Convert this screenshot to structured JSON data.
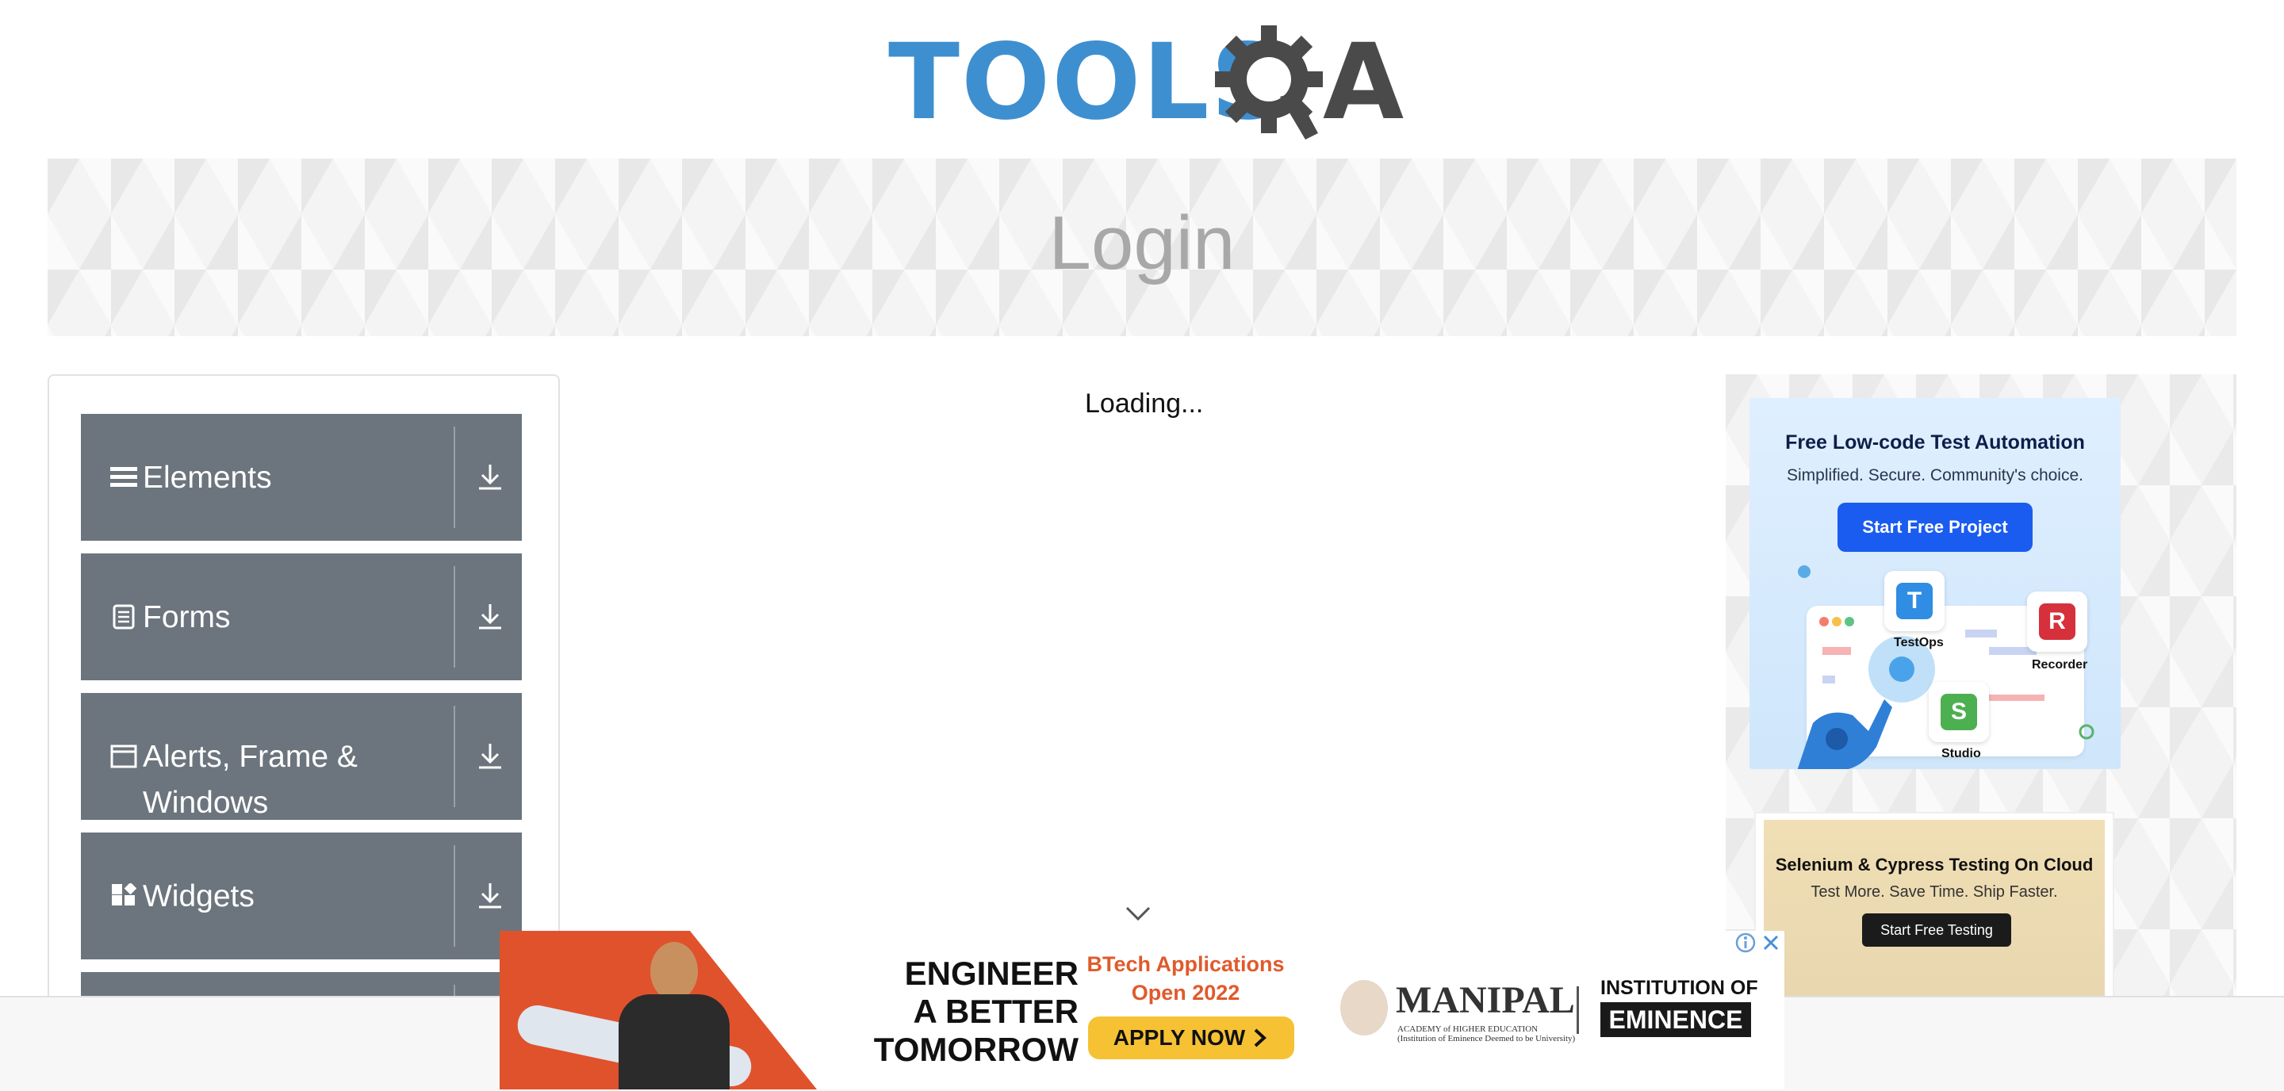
{
  "header": {
    "logo_text": "TOOLS",
    "logo_letter": "A"
  },
  "banner": {
    "title": "Login"
  },
  "sidebar": {
    "groups": [
      {
        "label": "Elements",
        "icon": "hamburger-icon"
      },
      {
        "label": "Forms",
        "icon": "document-icon"
      },
      {
        "label": "Alerts, Frame &",
        "label2": "Windows",
        "icon": "window-icon"
      },
      {
        "label": "Widgets",
        "icon": "widgets-icon"
      }
    ]
  },
  "main": {
    "loading_text": "Loading..."
  },
  "ads": {
    "right1": {
      "title": "Free Low-code Test Automation",
      "subtitle": "Simplified. Secure. Community's choice.",
      "button": "Start Free Project",
      "tiles": [
        {
          "letter": "T",
          "caption": "TestOps",
          "color": "#2f8de4"
        },
        {
          "letter": "R",
          "caption": "Recorder",
          "color": "#d6303c"
        },
        {
          "letter": "S",
          "caption": "Studio",
          "color": "#4caf50"
        }
      ]
    },
    "right2": {
      "title": "Selenium & Cypress Testing On Cloud",
      "subtitle": "Test More. Save Time. Ship Faster.",
      "button": "Start Free Testing"
    },
    "bottom": {
      "headline1": "ENGINEER",
      "headline2": "A BETTER",
      "headline3": "TOMORROW",
      "btech1": "BTech Applications",
      "btech2": "Open 2022",
      "apply": "APPLY NOW",
      "manipal": "MANIPAL",
      "academy": "ACADEMY of HIGHER EDUCATION",
      "academy_sub": "(Institution of Eminence Deemed to be University)",
      "institution": "INSTITUTION OF",
      "eminence": "EMINENCE"
    }
  },
  "colors": {
    "sidebar_group_bg": "#6c757d",
    "logo_blue": "#3e8fd0",
    "logo_dark": "#4a4a4a"
  }
}
